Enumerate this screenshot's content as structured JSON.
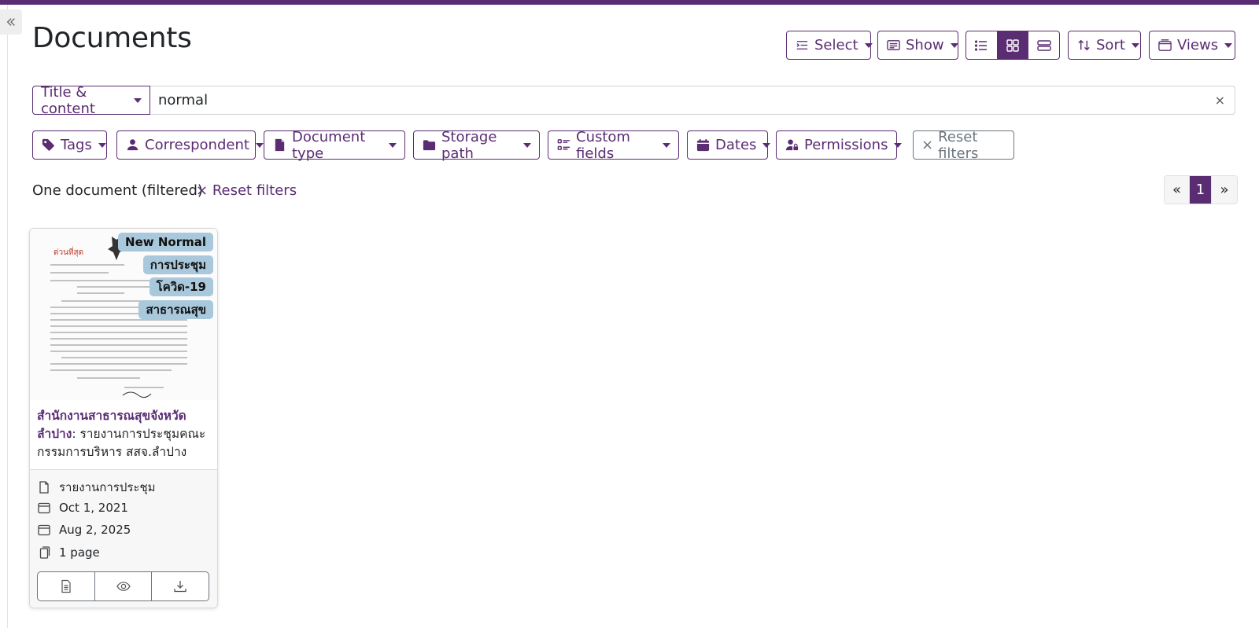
{
  "page": {
    "title": "Documents"
  },
  "toolbar": {
    "select_label": "Select",
    "show_label": "Show",
    "sort_label": "Sort",
    "views_label": "Views",
    "view_modes": [
      "list",
      "grid",
      "table"
    ],
    "active_view": "grid"
  },
  "search": {
    "mode_label": "Title & content",
    "query": "normal",
    "clear_glyph": "×"
  },
  "filters": {
    "tags": "Tags",
    "correspondent": "Correspondent",
    "document_type": "Document type",
    "storage_path": "Storage path",
    "custom_fields": "Custom fields",
    "dates": "Dates",
    "permissions": "Permissions",
    "reset": "Reset filters",
    "reset_glyph": "×"
  },
  "results": {
    "count_text": "One document (filtered)",
    "reset_link": "Reset filters",
    "reset_glyph": "×"
  },
  "pagination": {
    "prev": "«",
    "current": "1",
    "next": "»"
  },
  "documents": [
    {
      "tags": [
        "New Normal",
        "การประชุม",
        "โควิด-19",
        "สาธารณสุข"
      ],
      "correspondent": "สำนักงานสาธารณสุขจังหวัดลำปาง",
      "title": ": รายงานการประชุมคณะกรรมการบริหาร สสจ.ลำปาง",
      "document_type": "รายงานการประชุม",
      "created": "Oct 1, 2021",
      "added": "Aug 2, 2025",
      "pages": "1 page"
    }
  ],
  "colors": {
    "primary": "#5a2d73",
    "tag_bg": "#a9c8dc",
    "reset_border": "#6c757d"
  }
}
